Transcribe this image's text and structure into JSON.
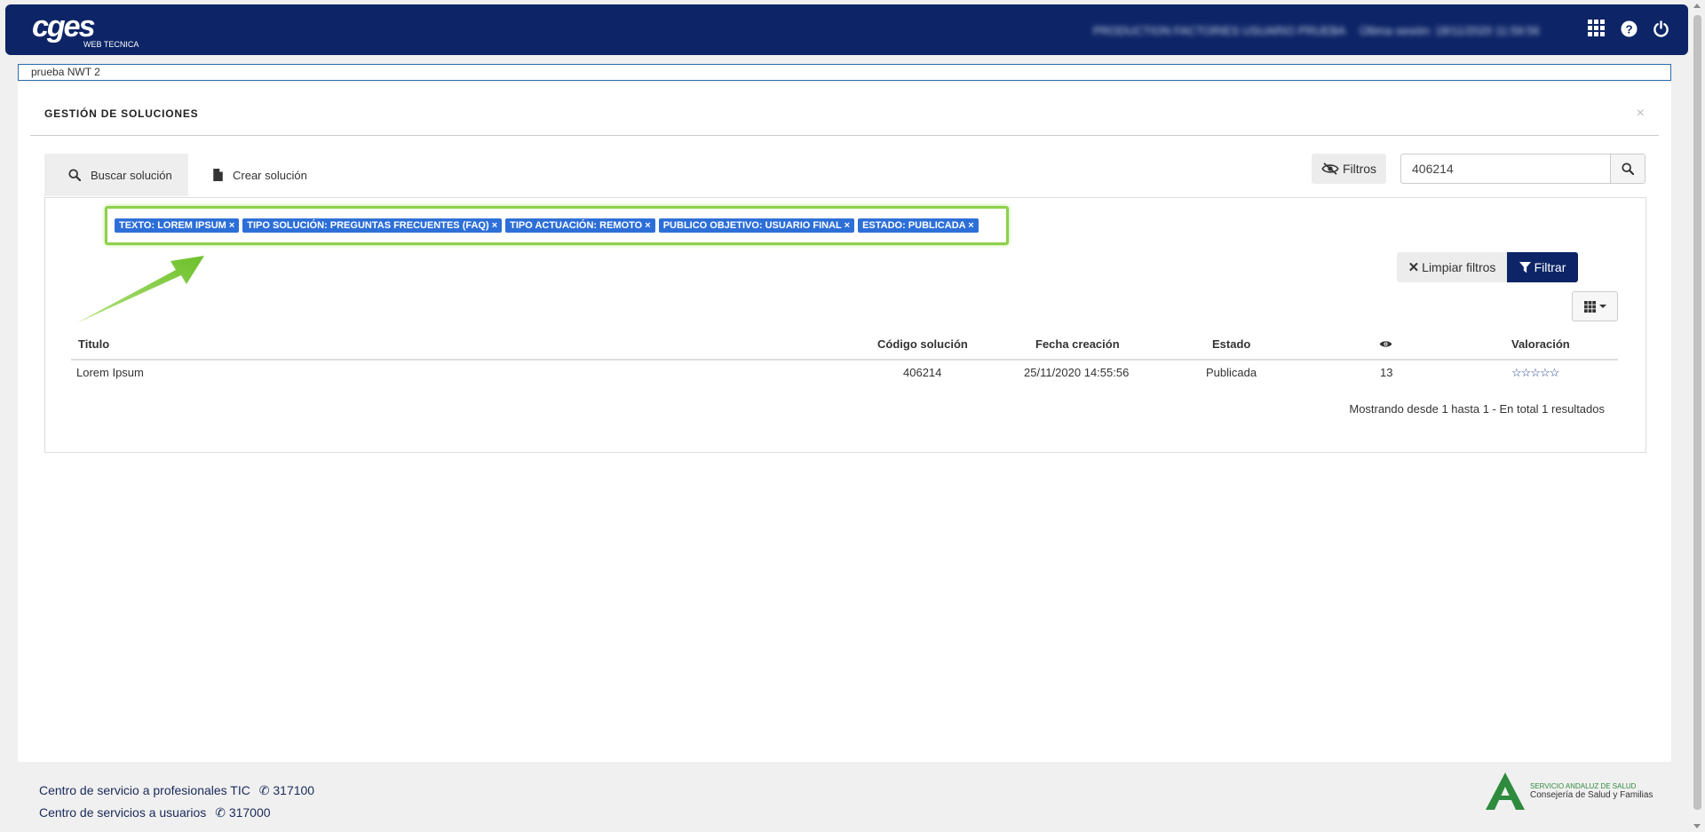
{
  "header": {
    "logo_main": "cges",
    "logo_sub": "WEB TECNICA",
    "user_info": "PRODUCTION FACTORIES USUARIO PRUEBA",
    "session_info": "Última sesión: 18/11/2020 11:59:56",
    "icons": [
      "apps-grid-icon",
      "help-icon",
      "power-icon"
    ]
  },
  "context_field": {
    "value": "prueba NWT 2"
  },
  "page": {
    "title": "GESTIÓN DE SOLUCIONES",
    "close": "×"
  },
  "tabs": [
    {
      "label": "Buscar solución",
      "icon": "search-icon"
    },
    {
      "label": "Crear solución",
      "icon": "document-icon"
    }
  ],
  "search": {
    "filters_label": "Filtros",
    "value": "406214"
  },
  "active_filters": [
    "TEXTO: LOREM IPSUM ×",
    "TIPO SOLUCIÓN: PREGUNTAS FRECUENTES (FAQ) ×",
    "TIPO ACTUACIÓN: REMOTO ×",
    "PUBLICO OBJETIVO: USUARIO FINAL ×",
    "ESTADO: PUBLICADA ×"
  ],
  "actions": {
    "clear_label": "Limpiar filtros",
    "filter_label": "Filtrar"
  },
  "table": {
    "headers": {
      "titulo": "Titulo",
      "codigo": "Código solución",
      "fecha": "Fecha creación",
      "estado": "Estado",
      "views_icon": "eye-icon",
      "valoracion": "Valoración"
    },
    "rows": [
      {
        "titulo": "Lorem Ipsum",
        "codigo": "406214",
        "fecha": "25/11/2020 14:55:56",
        "estado": "Publicada",
        "vistas": "13",
        "valoracion": "☆☆☆☆☆"
      }
    ],
    "summary": "Mostrando desde 1 hasta 1 - En total 1 resultados"
  },
  "footer": {
    "line1_label": "Centro de servicio a profesionales TIC",
    "line1_phone": "317100",
    "line2_label": "Centro de servicios a usuarios",
    "line2_phone": "317000",
    "sas_line1": "SERVICIO ANDALUZ DE SALUD",
    "sas_line2": "Consejería de Salud y Familias"
  },
  "colors": {
    "brand_navy": "#0d2567",
    "tag_blue": "#2d6fd8",
    "highlight_green": "#8dd04b"
  }
}
